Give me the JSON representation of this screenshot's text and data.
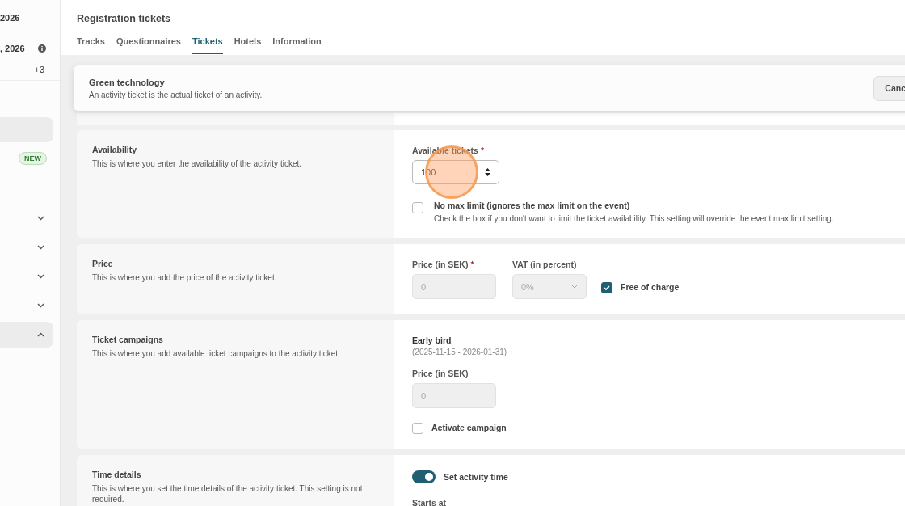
{
  "sidebar": {
    "items": [
      {
        "kind": "heading",
        "text": "2026"
      },
      {
        "kind": "info",
        "text": ", 2026"
      },
      {
        "kind": "count",
        "text": "+3"
      },
      {
        "kind": "blank",
        "selected": true
      },
      {
        "kind": "badge",
        "text": "NEW"
      },
      {
        "kind": "group",
        "expanded": false,
        "selected": false
      },
      {
        "kind": "group",
        "expanded": false,
        "selected": false
      },
      {
        "kind": "group",
        "expanded": false,
        "selected": false
      },
      {
        "kind": "group",
        "expanded": false,
        "selected": false
      },
      {
        "kind": "group",
        "expanded": true,
        "selected": true
      }
    ]
  },
  "header": {
    "title": "Registration tickets",
    "tabs": [
      {
        "label": "Tracks",
        "selected": false
      },
      {
        "label": "Questionnaires",
        "selected": false
      },
      {
        "label": "Tickets",
        "selected": true
      },
      {
        "label": "Hotels",
        "selected": false
      },
      {
        "label": "Information",
        "selected": false
      }
    ]
  },
  "card": {
    "title": "Green technology",
    "subtitle": "An activity ticket is the actual ticket of an activity.",
    "button": "Canc"
  },
  "sections": [
    {
      "kind": "availability",
      "title": "Availability",
      "description": "This is where you enter the availability of the activity ticket.",
      "field_label": "Available tickets",
      "required_mark": "*",
      "value": "100",
      "checkbox": {
        "label": "No max limit (ignores the max limit on the event)",
        "hint": "Check the box if you don't want to limit the ticket availability. This setting will override the event max limit setting.",
        "checked": false
      }
    },
    {
      "kind": "price",
      "title": "Price",
      "description": "This is where you add the price of the activity ticket.",
      "price_label": "Price (in SEK)",
      "required_mark": "*",
      "price_placeholder": "0",
      "vat_label": "VAT (in percent)",
      "vat_value": "0%",
      "checkbox": {
        "label": "Free of charge",
        "checked": true
      }
    },
    {
      "kind": "campaigns",
      "title": "Ticket campaigns",
      "description": "This is where you add available ticket campaigns to the activity ticket.",
      "campaign": "Early bird",
      "dates": "(2025-11-15 - 2026-01-31)",
      "price_label": "Price (in SEK)",
      "price_placeholder": "0",
      "checkbox": {
        "label": "Activate campaign",
        "checked": false
      }
    },
    {
      "kind": "time",
      "title": "Time details",
      "description": "This is where you set the time details of the activity ticket. This setting is not required.",
      "toggle": {
        "label": "Set activity time",
        "on": true
      },
      "field_label": "Starts at"
    }
  ]
}
